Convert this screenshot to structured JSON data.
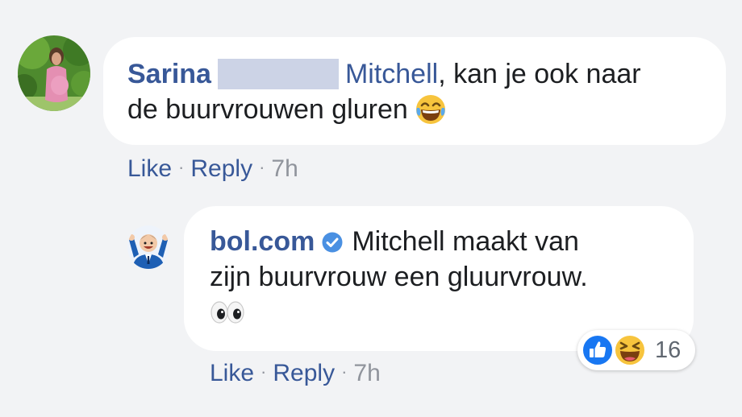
{
  "comment1": {
    "author_first": "Sarina",
    "mention": "Mitchell",
    "text_after_mention": ", kan je ook naar",
    "text_line2": "de buurvrouwen gluren",
    "emoji": "laughing-with-tears-emoji"
  },
  "comment1_actions": {
    "like": "Like",
    "sep1": "·",
    "reply": "Reply",
    "sep2": "·",
    "time": "7h"
  },
  "comment2": {
    "author": "bol.com",
    "text_line1": "Mitchell maakt van",
    "text_line2": "zijn buurvrouw een gluurvrouw.",
    "emoji": "eyes-emoji",
    "verified_icon": "verified-badge-icon"
  },
  "comment2_reactions": {
    "types": [
      "like",
      "haha"
    ],
    "count": "16"
  },
  "comment2_actions": {
    "like": "Like",
    "sep1": "·",
    "reply": "Reply",
    "sep2": "·",
    "time": "7h"
  },
  "colors": {
    "link": "#385898",
    "meta": "#90949c",
    "background": "#f2f3f5",
    "bubble": "#ffffff",
    "like_blue": "#1877f2",
    "haha_yellow": "#f7c43d",
    "verified_blue": "#4a90e2"
  }
}
